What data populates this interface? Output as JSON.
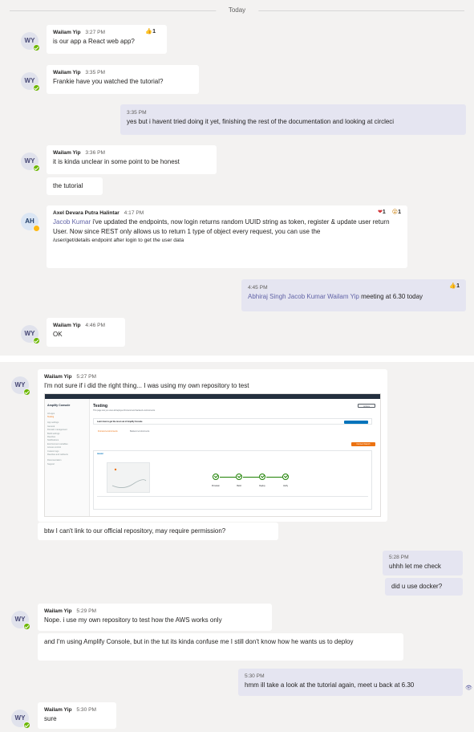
{
  "divider": "Today",
  "conversation1": [
    {
      "author": "Wailam Yip",
      "initials": "WY",
      "time": "3:27 PM",
      "reaction": "1",
      "text": "is our app a React web app?"
    },
    {
      "author": "Wailam Yip",
      "initials": "WY",
      "time": "3:35 PM",
      "text": "Frankie have you watched the tutorial?"
    },
    {
      "mine": true,
      "time": "3:35 PM",
      "text": "yes but i havent tried doing it yet, finishing the rest of the documentation and looking at circleci"
    },
    {
      "author": "Wailam Yip",
      "initials": "WY",
      "time": "3:36 PM",
      "text": "it is kinda unclear in some point to be honest",
      "followup": "the tutorial"
    },
    {
      "author": "Axel Devara Putra Halintar",
      "initials": "AH",
      "time": "4:17 PM",
      "heart_count": "1",
      "surprise_count": "1",
      "mention": "Jacob Kumar",
      "text_main": " i've updated the endpoints, now login returns random UUID string as token, register & update user return User. Now since REST only allows us to return 1 type of object every request, you can use the",
      "text_small": "/user/get/details endpoint after login to get the user data"
    },
    {
      "mine": true,
      "time": "4:45 PM",
      "like_count": "1",
      "mentions": "Abhiraj Singh Jacob Kumar Wailam Yip",
      "text": " meeting at 6.30 today"
    },
    {
      "author": "Wailam Yip",
      "initials": "WY",
      "time": "4:46 PM",
      "text": "OK"
    }
  ],
  "conversation2": [
    {
      "author": "Wailam Yip",
      "initials": "WY",
      "time": "5:27 PM",
      "text": "I'm not sure if i did the right thing... I was using my own repository to test",
      "followup": "btw I can't link to our official repository, may require permission?"
    },
    {
      "mine": true,
      "time": "5:28 PM",
      "text": "uhhh let me check",
      "followup": "did u use docker?"
    },
    {
      "author": "Wailam Yip",
      "initials": "WY",
      "time": "5:29 PM",
      "text": "Nope. i use my own repository to test how the AWS works only",
      "followup": "and I'm using Amplify Console, but in the tut its kinda confuse me I still don't know how he wants us to deploy"
    },
    {
      "mine": true,
      "time": "5:30 PM",
      "text": "hmm ill take a look at the tutorial again, meet u back at 6.30"
    },
    {
      "author": "Wailam Yip",
      "initials": "WY",
      "time": "5:30 PM",
      "text": "sure"
    }
  ],
  "screenshot": {
    "sidebar_title": "Amplify Console",
    "sidebar_items": [
      "All apps",
      "Testing",
      "App settings",
      "General",
      "Domain management",
      "Build settings",
      "Rewrites",
      "Notifications",
      "Environment variables",
      "Access control",
      "Custom logs",
      "Rewrites and redirects",
      "Documentation",
      "Support"
    ],
    "page_title": "Testing",
    "page_desc": "This page lets you view all deployed frontend and backend environments.",
    "learn_text": "Learn how to get the most out of Amplify Console",
    "tabs": [
      "Frontend environments",
      "Backend environments"
    ],
    "branch": "master",
    "stages": [
      "Provision",
      "Build",
      "Deploy",
      "Verify"
    ],
    "action_label": "Actions",
    "deploy_label": "Connect branch"
  },
  "colors": {
    "accent": "#6264a7",
    "presence": "#6bb700",
    "away": "#fdb913",
    "mine_bubble": "#e5e5f1"
  }
}
